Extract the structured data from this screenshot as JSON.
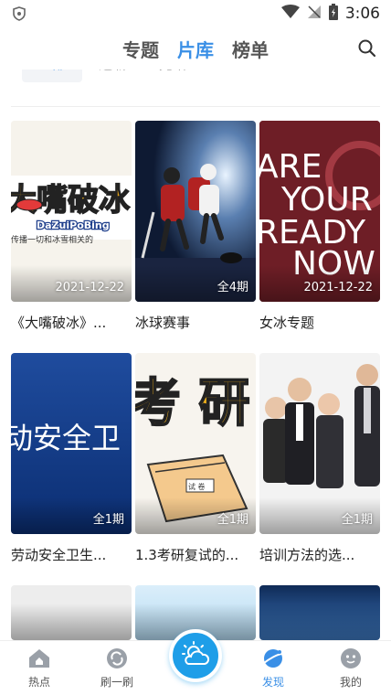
{
  "status": {
    "time": "3:06"
  },
  "topnav": {
    "tabs": [
      "专题",
      "片库",
      "榜单"
    ],
    "active": 1
  },
  "filters": [
    "全部",
    "连载",
    "完结"
  ],
  "cards": [
    {
      "title": "《大嘴破冰》...",
      "badge": "2021-12-22",
      "thumb_text": "大嘴破冰",
      "thumb_sub": "DaZuiPoBing",
      "thumb_caption": "传播一切和冰雪相关的"
    },
    {
      "title": "冰球赛事",
      "badge": "全4期"
    },
    {
      "title": "女冰专题",
      "badge": "2021-12-22",
      "thumb_lines": [
        "ARE",
        "YOUR",
        "READY",
        "NOW"
      ]
    },
    {
      "title": "劳动安全卫生...",
      "badge": "全1期",
      "thumb_text": "动安全卫"
    },
    {
      "title": "1.3考研复试的...",
      "badge": "全1期",
      "thumb_text": "考 研",
      "thumb_paper": "试 卷"
    },
    {
      "title": "培训方法的选...",
      "badge": "全1期"
    }
  ],
  "bottomnav": {
    "items": [
      "热点",
      "刷一刷",
      "发现",
      "我的"
    ],
    "active": 2
  },
  "colors": {
    "accent": "#3a8fe6",
    "center": "#1e9ee8"
  }
}
